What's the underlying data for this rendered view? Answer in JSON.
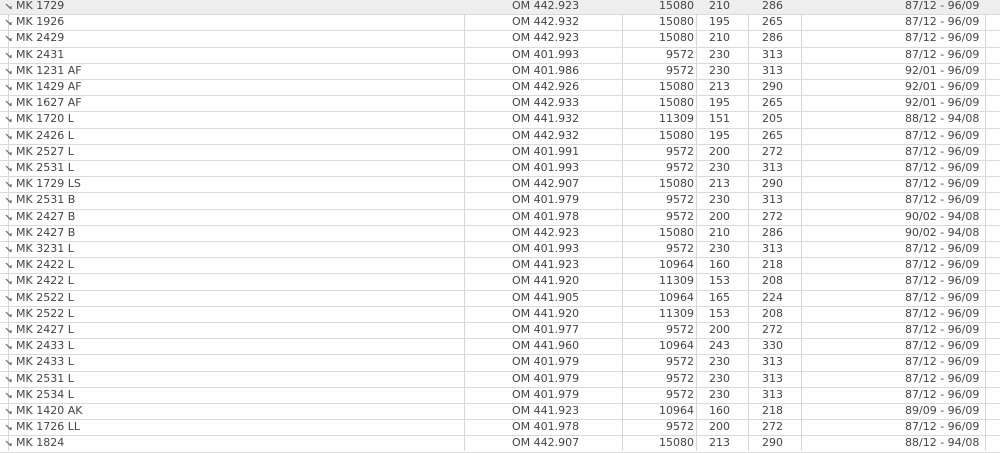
{
  "table": {
    "rows": [
      {
        "model": "MK 1729",
        "engine": "OM 442.923",
        "cc": "15080",
        "kw": "210",
        "hp": "286",
        "years": "87/12 - 96/09"
      },
      {
        "model": "MK 1926",
        "engine": "OM 442.932",
        "cc": "15080",
        "kw": "195",
        "hp": "265",
        "years": "87/12 - 96/09"
      },
      {
        "model": "MK 2429",
        "engine": "OM 442.923",
        "cc": "15080",
        "kw": "210",
        "hp": "286",
        "years": "87/12 - 96/09"
      },
      {
        "model": "MK 2431",
        "engine": "OM 401.993",
        "cc": "9572",
        "kw": "230",
        "hp": "313",
        "years": "87/12 - 96/09"
      },
      {
        "model": "MK 1231 AF",
        "engine": "OM 401.986",
        "cc": "9572",
        "kw": "230",
        "hp": "313",
        "years": "92/01 - 96/09"
      },
      {
        "model": "MK 1429 AF",
        "engine": "OM 442.926",
        "cc": "15080",
        "kw": "213",
        "hp": "290",
        "years": "92/01 - 96/09"
      },
      {
        "model": "MK 1627 AF",
        "engine": "OM 442.933",
        "cc": "15080",
        "kw": "195",
        "hp": "265",
        "years": "92/01 - 96/09"
      },
      {
        "model": "MK 1720 L",
        "engine": "OM 441.932",
        "cc": "11309",
        "kw": "151",
        "hp": "205",
        "years": "88/12 - 94/08"
      },
      {
        "model": "MK 2426 L",
        "engine": "OM 442.932",
        "cc": "15080",
        "kw": "195",
        "hp": "265",
        "years": "87/12 - 96/09"
      },
      {
        "model": "MK 2527 L",
        "engine": "OM 401.991",
        "cc": "9572",
        "kw": "200",
        "hp": "272",
        "years": "87/12 - 96/09"
      },
      {
        "model": "MK 2531 L",
        "engine": "OM 401.993",
        "cc": "9572",
        "kw": "230",
        "hp": "313",
        "years": "87/12 - 96/09"
      },
      {
        "model": "MK 1729 LS",
        "engine": "OM 442.907",
        "cc": "15080",
        "kw": "213",
        "hp": "290",
        "years": "87/12 - 96/09"
      },
      {
        "model": "MK 2531 B",
        "engine": "OM 401.979",
        "cc": "9572",
        "kw": "230",
        "hp": "313",
        "years": "87/12 - 96/09"
      },
      {
        "model": "MK 2427 B",
        "engine": "OM 401.978",
        "cc": "9572",
        "kw": "200",
        "hp": "272",
        "years": "90/02 - 94/08"
      },
      {
        "model": "MK 2427 B",
        "engine": "OM 442.923",
        "cc": "15080",
        "kw": "210",
        "hp": "286",
        "years": "90/02 - 94/08"
      },
      {
        "model": "MK 3231 L",
        "engine": "OM 401.993",
        "cc": "9572",
        "kw": "230",
        "hp": "313",
        "years": "87/12 - 96/09"
      },
      {
        "model": "MK 2422 L",
        "engine": "OM 441.923",
        "cc": "10964",
        "kw": "160",
        "hp": "218",
        "years": "87/12 - 96/09"
      },
      {
        "model": "MK 2422 L",
        "engine": "OM 441.920",
        "cc": "11309",
        "kw": "153",
        "hp": "208",
        "years": "87/12 - 96/09"
      },
      {
        "model": "MK 2522 L",
        "engine": "OM 441.905",
        "cc": "10964",
        "kw": "165",
        "hp": "224",
        "years": "87/12 - 96/09"
      },
      {
        "model": "MK 2522 L",
        "engine": "OM 441.920",
        "cc": "11309",
        "kw": "153",
        "hp": "208",
        "years": "87/12 - 96/09"
      },
      {
        "model": "MK 2427 L",
        "engine": "OM 401.977",
        "cc": "9572",
        "kw": "200",
        "hp": "272",
        "years": "87/12 - 96/09"
      },
      {
        "model": "MK 2433 L",
        "engine": "OM 441.960",
        "cc": "10964",
        "kw": "243",
        "hp": "330",
        "years": "87/12 - 96/09"
      },
      {
        "model": "MK 2433 L",
        "engine": "OM 401.979",
        "cc": "9572",
        "kw": "230",
        "hp": "313",
        "years": "87/12 - 96/09"
      },
      {
        "model": "MK 2531 L",
        "engine": "OM 401.979",
        "cc": "9572",
        "kw": "230",
        "hp": "313",
        "years": "87/12 - 96/09"
      },
      {
        "model": "MK 2534 L",
        "engine": "OM 401.979",
        "cc": "9572",
        "kw": "230",
        "hp": "313",
        "years": "87/12 - 96/09"
      },
      {
        "model": "MK 1420 AK",
        "engine": "OM 441.923",
        "cc": "10964",
        "kw": "160",
        "hp": "218",
        "years": "89/09 - 96/09"
      },
      {
        "model": "MK 1726 LL",
        "engine": "OM 401.978",
        "cc": "9572",
        "kw": "200",
        "hp": "272",
        "years": "87/12 - 96/09"
      },
      {
        "model": "MK 1824",
        "engine": "OM 442.907",
        "cc": "15080",
        "kw": "213",
        "hp": "290",
        "years": "88/12 - 94/08"
      }
    ]
  }
}
